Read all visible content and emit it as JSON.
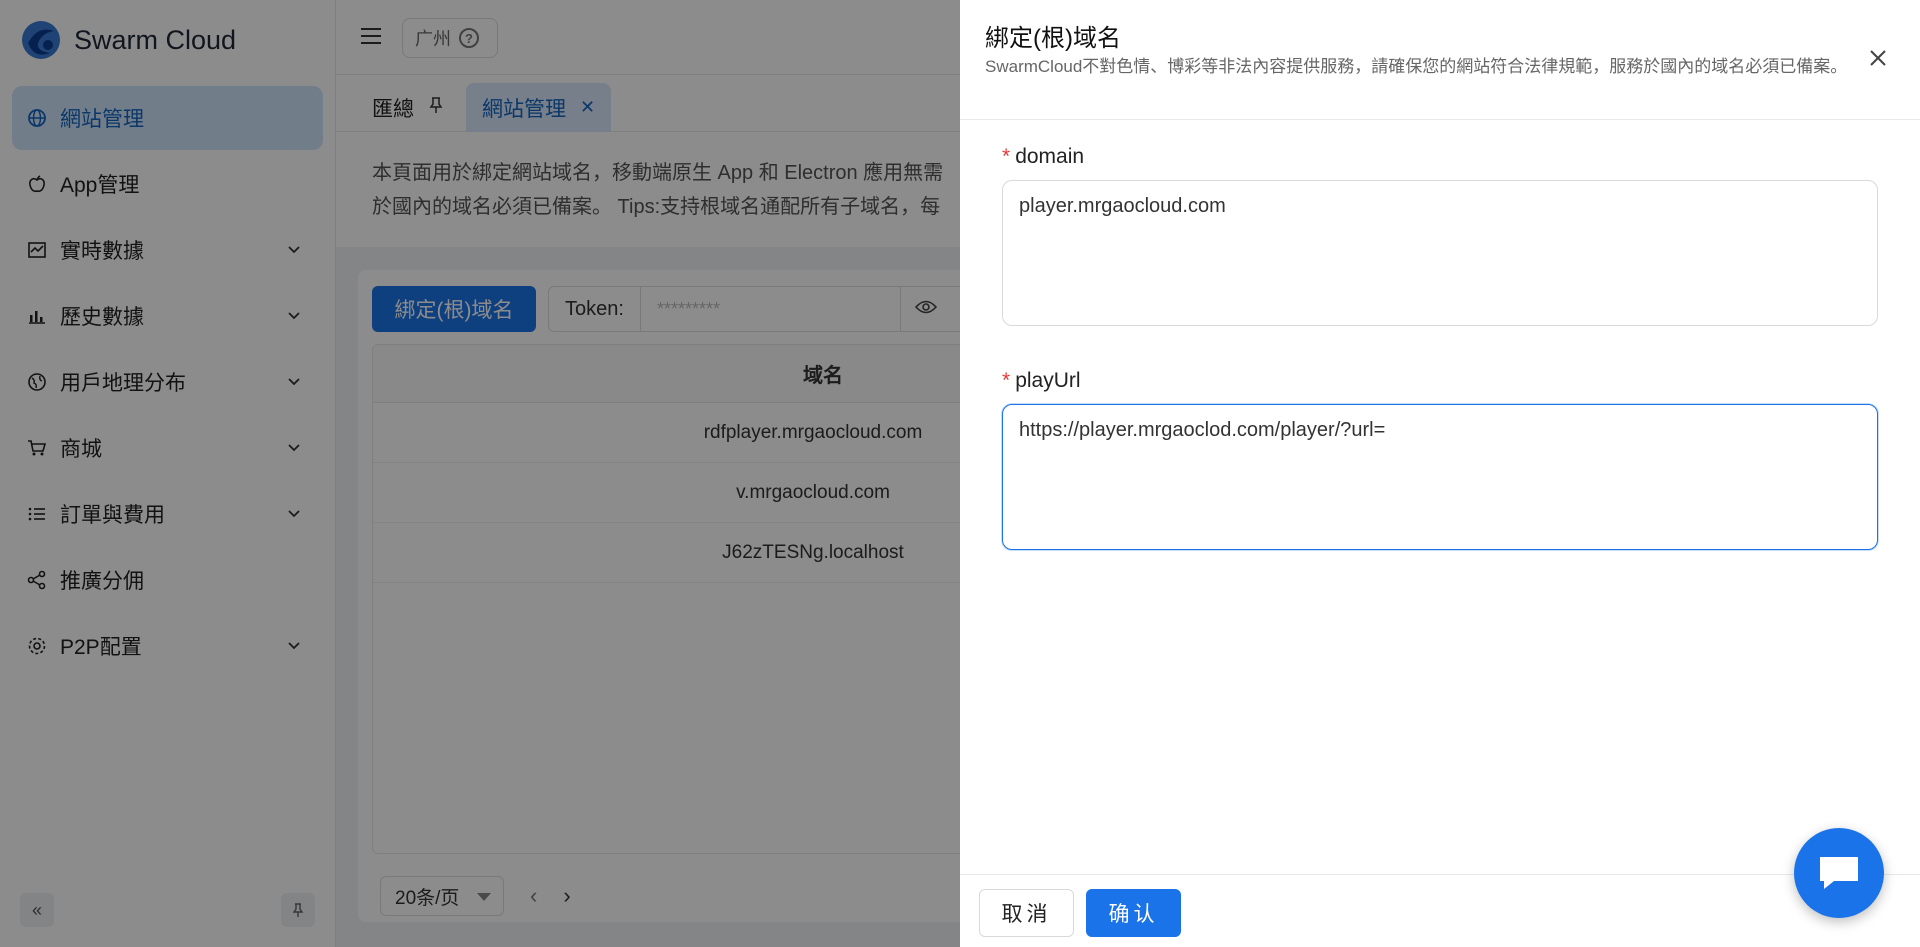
{
  "app": {
    "name": "Swarm Cloud"
  },
  "sidebar": {
    "items": [
      {
        "label": "網站管理",
        "icon": "globe-icon",
        "active": true,
        "expandable": false
      },
      {
        "label": "App管理",
        "icon": "apple-icon",
        "active": false,
        "expandable": false
      },
      {
        "label": "實時數據",
        "icon": "realtime-chart-icon",
        "active": false,
        "expandable": true
      },
      {
        "label": "歷史數據",
        "icon": "bar-chart-icon",
        "active": false,
        "expandable": true
      },
      {
        "label": "用戶地理分布",
        "icon": "earth-icon",
        "active": false,
        "expandable": true
      },
      {
        "label": "商城",
        "icon": "cart-icon",
        "active": false,
        "expandable": true
      },
      {
        "label": "訂單與費用",
        "icon": "list-icon",
        "active": false,
        "expandable": true
      },
      {
        "label": "推廣分佣",
        "icon": "share-icon",
        "active": false,
        "expandable": false
      },
      {
        "label": "P2P配置",
        "icon": "gear-icon",
        "active": false,
        "expandable": true
      }
    ]
  },
  "header": {
    "region": "广州"
  },
  "tabs": [
    {
      "label": "匯總",
      "icon": "pin-icon"
    },
    {
      "label": "網站管理",
      "icon": "close-icon"
    }
  ],
  "main": {
    "description_line1": "本頁面用於綁定網站域名，移動端原生 App 和 Electron 應用無需",
    "description_line2": "於國內的域名必須已備案。 Tips:支持根域名通配所有子域名，每",
    "bind_button": "綁定(根)域名",
    "token_label": "Token:",
    "token_value": "*********",
    "table": {
      "header": "域名",
      "rows": [
        "rdfplayer.mrgaocloud.com",
        "v.mrgaocloud.com",
        "J62zTESNg.localhost"
      ]
    },
    "pager": {
      "page_size": "20条/页"
    }
  },
  "drawer": {
    "title": "綁定(根)域名",
    "subtitle": "SwarmCloud不對色情、博彩等非法內容提供服務，請確保您的網站符合法律規範，服務於國內的域名必須已備案。",
    "fields": {
      "domain": {
        "label": "domain",
        "value": "player.mrgaocloud.com"
      },
      "playUrl": {
        "label": "playUrl",
        "value": "https://player.mrgaoclod.com/player/?url="
      }
    },
    "cancel_label": "取消",
    "confirm_label": "确认"
  },
  "colors": {
    "primary": "#1a73e8",
    "required": "#e53935",
    "active_bg": "#cfe3fb"
  }
}
